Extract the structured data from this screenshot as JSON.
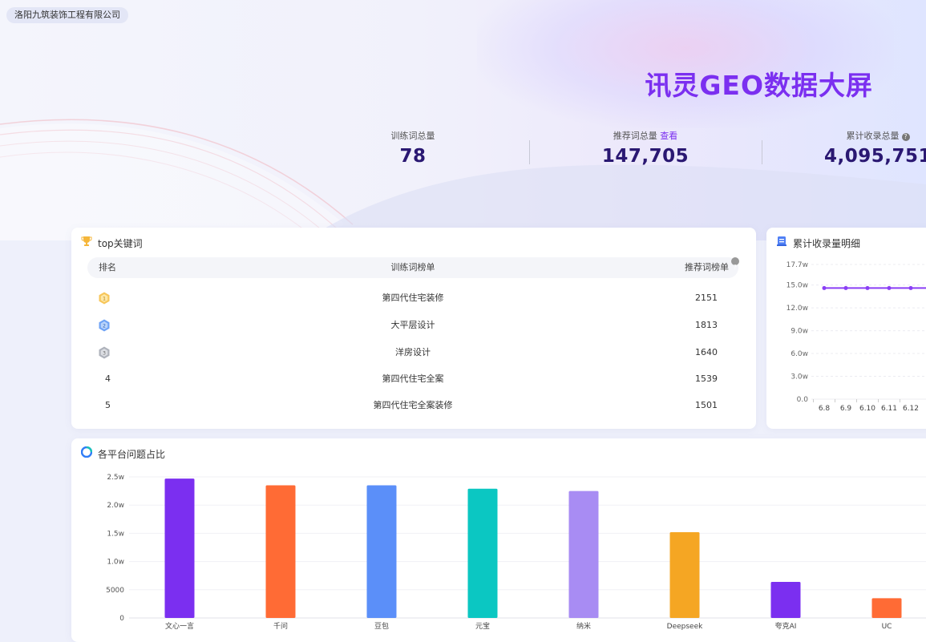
{
  "company": "洛阳九筑装饰工程有限公司",
  "title": "讯灵GEO数据大屏",
  "stats": [
    {
      "label": "训练词总量",
      "value": "78"
    },
    {
      "label": "推荐词总量",
      "link": "查看",
      "value": "147,705"
    },
    {
      "label": "累计收录总量",
      "value": "4,095,751"
    }
  ],
  "top_keywords": {
    "title": "top关键词",
    "headers": {
      "rank": "排名",
      "name": "训练词榜单",
      "count": "推荐词榜单"
    },
    "rows": [
      {
        "rank": "1",
        "name": "第四代住宅装修",
        "count": "2151"
      },
      {
        "rank": "2",
        "name": "大平层设计",
        "count": "1813"
      },
      {
        "rank": "3",
        "name": "洋房设计",
        "count": "1640"
      },
      {
        "rank": "4",
        "name": "第四代住宅全案",
        "count": "1539"
      },
      {
        "rank": "5",
        "name": "第四代住宅全案装修",
        "count": "1501"
      }
    ]
  },
  "accumulated": {
    "title": "累计收录量明细"
  },
  "platform": {
    "title": "各平台问题占比"
  },
  "colors": {
    "accent": "#7b2ff0",
    "stat_value": "#2a1872"
  },
  "chart_data": [
    {
      "type": "line",
      "x": [
        "6.8",
        "6.9",
        "6.10",
        "6.11",
        "6.12"
      ],
      "values": [
        14.6,
        14.6,
        14.6,
        14.6,
        14.6
      ],
      "y_ticks": [
        "0.0",
        "3.0w",
        "6.0w",
        "9.0w",
        "12.0w",
        "15.0w",
        "17.7w"
      ],
      "ylim": [
        0,
        17.7
      ],
      "color": "#8a3ff5",
      "grid": true
    },
    {
      "type": "bar",
      "categories": [
        "文心一言",
        "千问",
        "豆包",
        "元宝",
        "纳米",
        "Deepseek",
        "夸克AI",
        "UC"
      ],
      "values": [
        24700,
        23500,
        23500,
        22900,
        22500,
        15200,
        6400,
        3500
      ],
      "colors": [
        "#7b2ff0",
        "#ff6b35",
        "#5b8ff9",
        "#0bc7c2",
        "#a88cf3",
        "#f5a623",
        "#7b2ff0",
        "#ff6b35"
      ],
      "y_ticks": [
        "0",
        "5000",
        "1.0w",
        "1.5w",
        "2.0w",
        "2.5w"
      ],
      "ylim": [
        0,
        25000
      ],
      "grid": true
    }
  ]
}
